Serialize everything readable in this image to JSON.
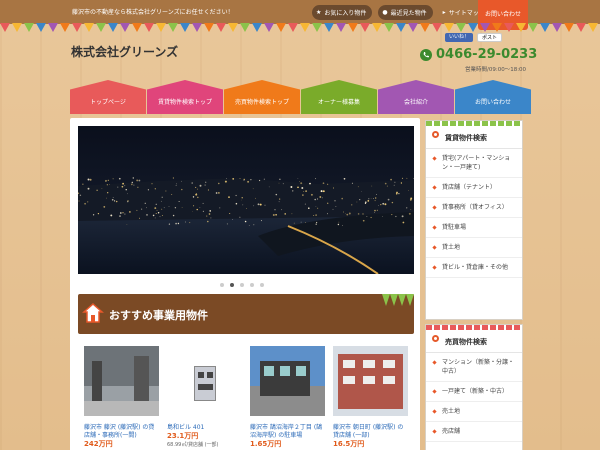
{
  "header": {
    "tagline": "藤沢市の不動産なら株式会社グリーンズにお任せください！",
    "links": [
      {
        "label": "お気に入り物件",
        "icon": "star-icon"
      },
      {
        "label": "最近見た物件",
        "icon": "clock-icon"
      },
      {
        "label": "サイトマップ",
        "icon": "chevron-right-icon"
      }
    ],
    "contact_label": "お問い合わせ",
    "logo": "株式会社グリーンズ",
    "social": {
      "facebook": "いいね！",
      "x": "ポスト"
    },
    "tel": "0466-29-0233",
    "hours": "営業時間/09:00～18:00"
  },
  "nav": [
    {
      "label": "トップページ",
      "color": "#e85a5a"
    },
    {
      "label": "賃貸物件検索トップ",
      "color": "#e0457b"
    },
    {
      "label": "売買物件検索トップ",
      "color": "#f07a1a"
    },
    {
      "label": "オーナー様募集",
      "color": "#7aab2a"
    },
    {
      "label": "会社紹介",
      "color": "#a257b2"
    },
    {
      "label": "お問い合わせ",
      "color": "#3b86c9"
    }
  ],
  "slider": {
    "dots": 5,
    "active": 1
  },
  "section": {
    "title": "おすすめ事業用物件"
  },
  "cards": [
    {
      "name": "藤沢市 藤沢 (藤沢駅) の貸店舗・事務所(一間)",
      "price": "242万円",
      "meta": ""
    },
    {
      "name": "島和ビル 401",
      "price": "23.1万円",
      "meta": "68.99㎡/貸店舗 (一部)"
    },
    {
      "name": "藤沢市 鵠沼海岸２丁目 (鵠沼海岸駅) の駐車場",
      "price": "1.65万円",
      "meta": ""
    },
    {
      "name": "藤沢市 朝日町 (藤沢駅) の貸店舗 (一部)",
      "price": "16.5万円",
      "meta": ""
    }
  ],
  "sidebar_rent": {
    "title": "賃貸物件検索",
    "items": [
      "貸宅(アパート・マンション・一戸建て)",
      "貸店舗（テナント）",
      "貸事務所（貸オフィス）",
      "貸駐車場",
      "貸土地",
      "貸ビル・貸倉庫・その他"
    ]
  },
  "sidebar_sale": {
    "title": "売買物件検索",
    "items": [
      "マンション（新築・分譲・中古）",
      "一戸建て（新築・中古）",
      "売土地",
      "売店舗"
    ]
  }
}
